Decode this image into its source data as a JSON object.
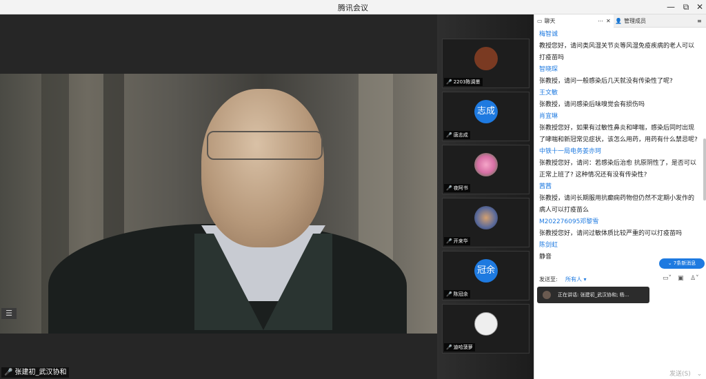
{
  "window": {
    "title": "腾讯会议",
    "controls": [
      "—",
      "⧉",
      "✕"
    ]
  },
  "main": {
    "speaker_name": "张建初_武汉协和",
    "list_icon": "☰"
  },
  "participants": [
    {
      "name": "2203陈调墨",
      "avatar_text": "",
      "avatar_color": "#7a3a22"
    },
    {
      "name": "唐志成",
      "avatar_text": "志成",
      "avatar_color": "#1e7ae0"
    },
    {
      "name": "夜阿书",
      "avatar_text": "",
      "avatar_color": "#d76fa5"
    },
    {
      "name": "开来华",
      "avatar_text": "",
      "avatar_color": "#5a6a9a"
    },
    {
      "name": "陈冠余",
      "avatar_text": "冠余",
      "avatar_color": "#1e7ae0"
    },
    {
      "name": "迪哈菠萝",
      "avatar_text": "",
      "avatar_color": "#eeeeee"
    }
  ],
  "chat": {
    "tab_chat": "聊天",
    "tab_more": "⋯",
    "tab_close": "✕",
    "tab_members": "管理成员",
    "menu_icon": "≡",
    "messages": [
      {
        "sender": "梅智诚",
        "text": "教授您好，请问类风湿关节炎等风湿免疫疾病的老人可以打疫苗吗"
      },
      {
        "sender": "智晓琛",
        "text": "张教授，请问一般感染后几天就没有传染性了呢?"
      },
      {
        "sender": "王文敏",
        "text": "张教授，请问感染后味嗅觉会有损伤吗"
      },
      {
        "sender": "肖宜琳",
        "text": "张教授您好，如果有过敏性鼻炎和哮喘，感染后同时出现了哮喘和新冠常见症状，该怎么用药，用药有什么禁忌呢?"
      },
      {
        "sender": "中铁十一局电务姜亦珂",
        "text": "张教授您好，请问：若感染后治愈 抗原阴性了，是否可以正常上班了? 这种情况还有没有传染性?"
      },
      {
        "sender": "茜茜",
        "text": "张教授，请问长期服用抗癫痫药物但仍然不定期小发作的病人可以打疫苗么"
      },
      {
        "sender": "M202276095邓黎雪",
        "text": "张教授您好，请问过敏体质比较严重的可以打疫苗吗"
      },
      {
        "sender": "陈剑虹",
        "text": "静音"
      }
    ],
    "new_messages": "⌄ 7条新消息",
    "send_to_label": "发送至:",
    "send_to_target": "所有人 ▾",
    "talking_text": "正在讲话: 张建初_武汉协和; 杨...",
    "send_button": "发送(S)",
    "send_menu": "⌄"
  }
}
